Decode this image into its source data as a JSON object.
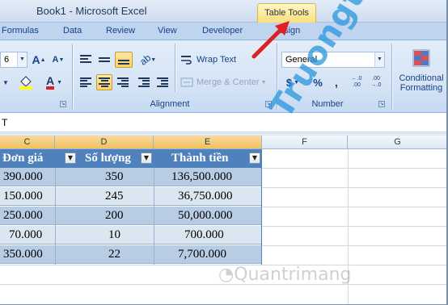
{
  "window": {
    "title": "Book1 - Microsoft Excel",
    "context_tab": "Table Tools"
  },
  "tabs": [
    "Formulas",
    "Data",
    "Review",
    "View",
    "Developer",
    "esign"
  ],
  "ribbon": {
    "font_size": "6",
    "grow_font": "A",
    "shrink_font": "A",
    "font_color_letter": "A",
    "wrap_text": "Wrap Text",
    "merge_center": "Merge & Center",
    "alignment_label": "Alignment",
    "number_format": "General",
    "currency": "$",
    "percent": "%",
    "comma": ",",
    "inc_decimal": "←.0\n.00",
    "dec_decimal": ".00\n→.0",
    "number_label": "Number",
    "conditional": "Conditional",
    "formatting": "Formatting"
  },
  "formula_bar": {
    "content": "T"
  },
  "columns": [
    "C",
    "D",
    "E",
    "F",
    "G"
  ],
  "table": {
    "headers": [
      "Đơn giá",
      "Số lượng",
      "Thành tiền"
    ],
    "rows": [
      [
        "390.000",
        "350",
        "136,500.000"
      ],
      [
        "150.000",
        "245",
        "36,750.000"
      ],
      [
        "250.000",
        "200",
        "50,000.000"
      ],
      [
        "70.000",
        "10",
        "700.000"
      ],
      [
        "350.000",
        "22",
        "7,700.000"
      ]
    ]
  },
  "watermark": {
    "diagonal": "Truongthinh.top",
    "bottom": "Quantrimang"
  },
  "colors": {
    "table_header": "#4f81bd",
    "band_dark": "#b8cce4",
    "band_light": "#dce6f1",
    "arrow": "#e02020",
    "watermark": "#2896dc"
  }
}
